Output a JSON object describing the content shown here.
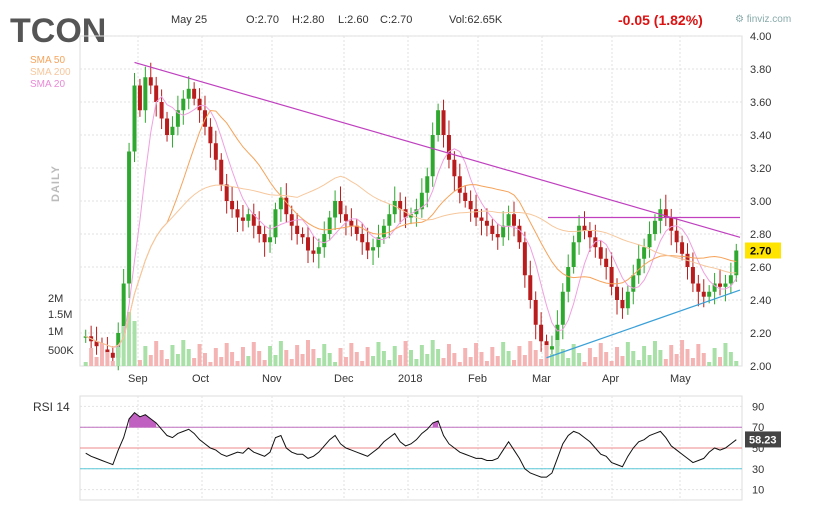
{
  "header": {
    "ticker": "TCON",
    "date": "May 25",
    "open": "O:2.70",
    "high": "H:2.80",
    "low": "L:2.60",
    "close": "C:2.70",
    "volume": "Vol:62.65K",
    "change": "-0.05 (1.82%)",
    "brand": "finviz.com",
    "timeframe": "DAILY"
  },
  "legend": [
    {
      "name": "SMA 50",
      "color": "#f6a35a"
    },
    {
      "name": "SMA 200",
      "color": "#f6c79c"
    },
    {
      "name": "SMA 20",
      "color": "#e88ad6"
    }
  ],
  "colors": {
    "up": "#2fa82f",
    "down": "#b91c1c",
    "trend": "#c040c0",
    "support": "#3aa0d8",
    "sma20": "#f0a0e0",
    "sma50": "#f6a35a",
    "sma200": "#f6c79c",
    "vol_up": "#a8e0a8",
    "vol_down": "#f4b4b4"
  },
  "chart_data": [
    {
      "type": "candlestick",
      "yticks": [
        "4.00",
        "3.80",
        "3.60",
        "3.40",
        "3.20",
        "3.00",
        "2.80",
        "2.60",
        "2.40",
        "2.20",
        "2.00"
      ],
      "ylim": [
        2.0,
        4.0
      ],
      "xticks": [
        "Sep",
        "Oct",
        "Nov",
        "Dec",
        "2018",
        "Feb",
        "Mar",
        "Apr",
        "May"
      ],
      "last_price_label": "2.70",
      "volume_ticks": [
        "2M",
        "1.5M",
        "1M",
        "500K"
      ],
      "closes": [
        2.18,
        2.15,
        2.12,
        2.1,
        2.08,
        2.05,
        2.2,
        2.5,
        3.3,
        3.7,
        3.55,
        3.75,
        3.7,
        3.6,
        3.5,
        3.4,
        3.45,
        3.55,
        3.62,
        3.68,
        3.62,
        3.55,
        3.45,
        3.35,
        3.25,
        3.1,
        3.0,
        2.95,
        2.9,
        2.88,
        2.92,
        2.85,
        2.8,
        2.75,
        2.78,
        2.95,
        3.02,
        2.92,
        2.85,
        2.8,
        2.78,
        2.7,
        2.68,
        2.72,
        2.8,
        2.9,
        3.0,
        2.92,
        2.88,
        2.85,
        2.8,
        2.75,
        2.7,
        2.72,
        2.78,
        2.85,
        2.92,
        3.0,
        2.95,
        2.9,
        2.92,
        2.95,
        3.05,
        3.15,
        3.4,
        3.55,
        3.4,
        3.25,
        3.15,
        3.05,
        3.0,
        2.95,
        2.9,
        2.88,
        2.85,
        2.8,
        2.78,
        2.85,
        2.92,
        2.85,
        2.75,
        2.55,
        2.4,
        2.25,
        2.15,
        2.1,
        2.12,
        2.25,
        2.45,
        2.6,
        2.75,
        2.85,
        2.82,
        2.78,
        2.72,
        2.65,
        2.6,
        2.48,
        2.4,
        2.35,
        2.45,
        2.55,
        2.65,
        2.72,
        2.8,
        2.88,
        2.95,
        2.9,
        2.82,
        2.75,
        2.68,
        2.6,
        2.5,
        2.45,
        2.42,
        2.45,
        2.5,
        2.48,
        2.5,
        2.55,
        2.7
      ],
      "rsi": {
        "label": "RSI 14",
        "yticks": [
          "90",
          "70",
          "50",
          "30",
          "10"
        ],
        "overbought": 70,
        "oversold": 30,
        "last": "58.23",
        "values": [
          45,
          42,
          40,
          38,
          36,
          34,
          48,
          60,
          78,
          84,
          80,
          82,
          78,
          74,
          68,
          62,
          60,
          64,
          66,
          68,
          64,
          58,
          54,
          50,
          48,
          44,
          42,
          44,
          46,
          45,
          50,
          46,
          44,
          42,
          46,
          60,
          62,
          50,
          46,
          44,
          44,
          40,
          42,
          46,
          52,
          58,
          62,
          54,
          50,
          48,
          46,
          44,
          42,
          46,
          50,
          56,
          60,
          64,
          56,
          52,
          54,
          58,
          64,
          68,
          74,
          76,
          62,
          54,
          50,
          46,
          44,
          42,
          40,
          40,
          38,
          38,
          40,
          48,
          56,
          48,
          40,
          30,
          26,
          24,
          22,
          22,
          26,
          40,
          54,
          62,
          66,
          64,
          60,
          56,
          50,
          44,
          42,
          36,
          34,
          32,
          42,
          50,
          56,
          58,
          62,
          64,
          66,
          60,
          52,
          48,
          44,
          40,
          36,
          38,
          40,
          46,
          50,
          48,
          50,
          54,
          58
        ]
      }
    }
  ]
}
